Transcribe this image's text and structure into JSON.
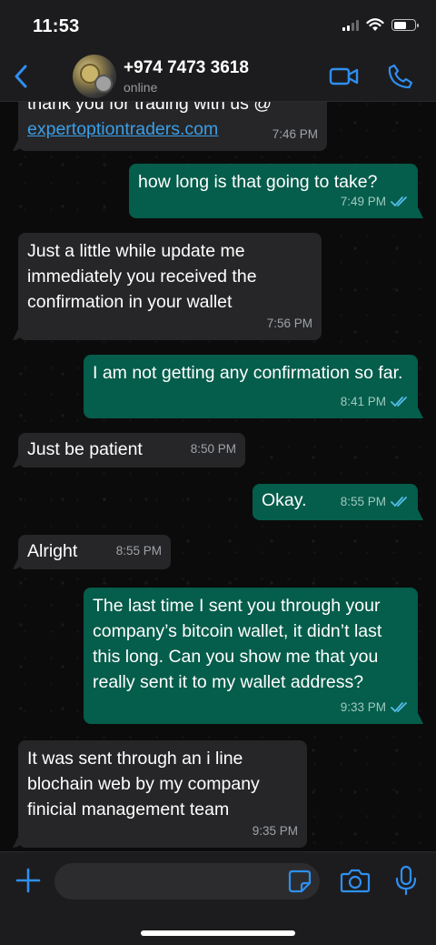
{
  "status_bar": {
    "time": "11:53"
  },
  "header": {
    "contact_name": "+974 7473 3618",
    "contact_status": "online"
  },
  "messages": [
    {
      "direction": "in",
      "text": "thank you for trading with us @",
      "link": "expertoptiontraders.com",
      "time": "7:46 PM"
    },
    {
      "direction": "out",
      "text": "how long is that going to take?",
      "time": "7:49 PM",
      "read": true
    },
    {
      "direction": "in",
      "text": "Just a little while update me immediately you received the confirmation in your wallet",
      "time": "7:56 PM"
    },
    {
      "direction": "out",
      "text": "I am not getting any confirmation so far.",
      "time": "8:41 PM",
      "read": true
    },
    {
      "direction": "in",
      "text": "Just be patient",
      "time": "8:50 PM"
    },
    {
      "direction": "out",
      "text": "Okay.",
      "time": "8:55 PM",
      "read": true
    },
    {
      "direction": "in",
      "text": "Alright",
      "time": "8:55 PM"
    },
    {
      "direction": "out",
      "text": "The last time I sent you through your company’s bitcoin wallet, it didn’t last this long. Can you show me that you really sent it to my wallet address?",
      "time": "9:33 PM",
      "read": true
    },
    {
      "direction": "in",
      "text": "It was sent through an i line blochain web by my company finicial management team",
      "time": "9:35 PM"
    }
  ],
  "input": {
    "placeholder": ""
  },
  "colors": {
    "accent": "#3b9ee6",
    "outgoing_bubble": "#055d4b",
    "incoming_bubble": "#262628",
    "read_ticks": "#53bdeb"
  }
}
